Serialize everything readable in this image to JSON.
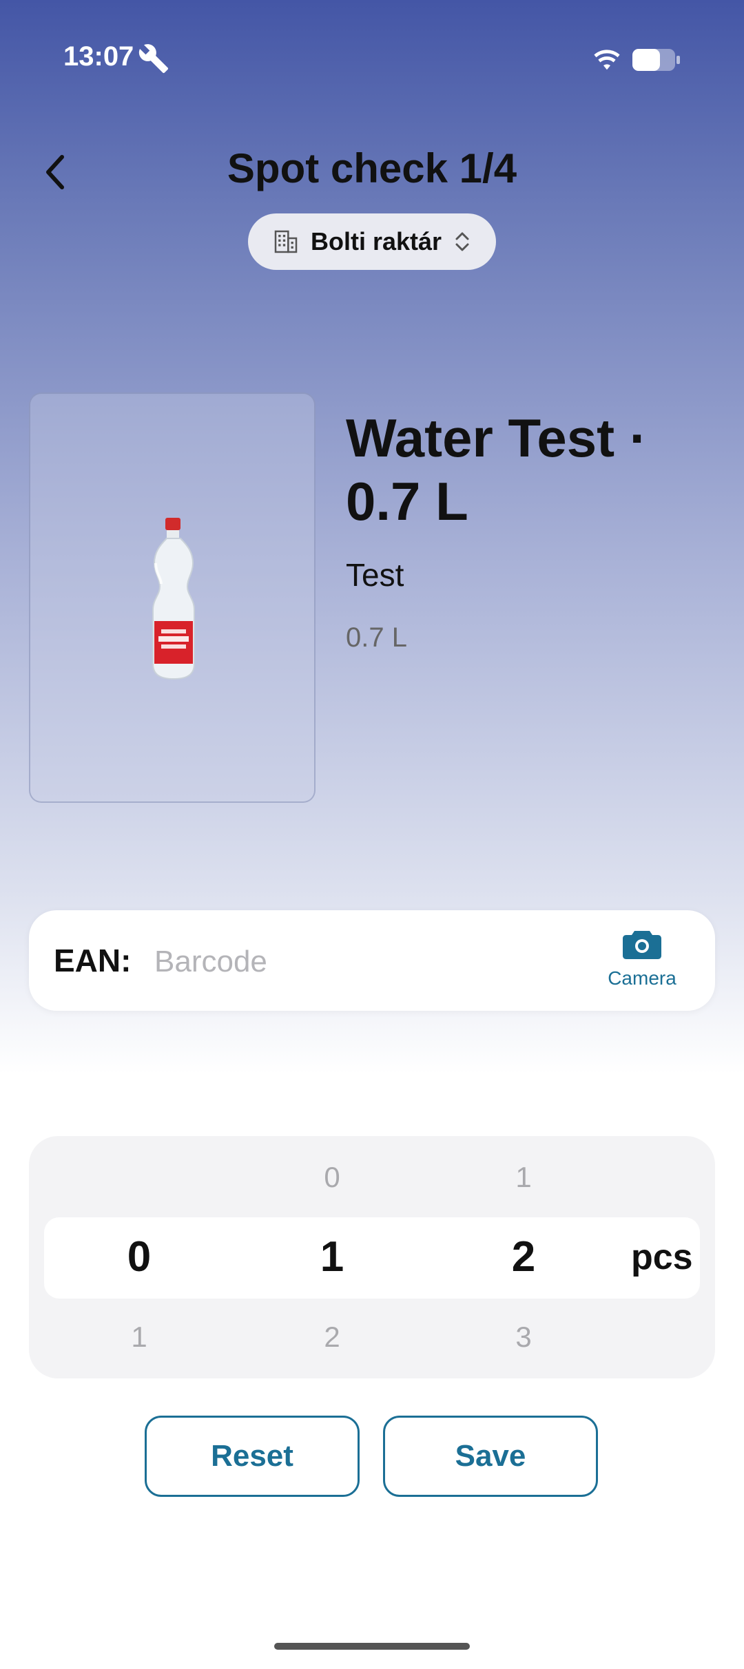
{
  "status_bar": {
    "time": "13:07"
  },
  "header": {
    "title": "Spot check  1/4"
  },
  "location": {
    "label": "Bolti raktár"
  },
  "product": {
    "title": "Water Test · 0.7 L",
    "subtitle": "Test",
    "size": "0.7 L"
  },
  "ean": {
    "label": "EAN:",
    "value": "",
    "placeholder": "Barcode",
    "camera_label": "Camera"
  },
  "quantity_picker": {
    "columns": [
      {
        "above": "",
        "current": "0",
        "below": "1"
      },
      {
        "above": "0",
        "current": "1",
        "below": "2"
      },
      {
        "above": "1",
        "current": "2",
        "below": "3"
      }
    ],
    "unit": "pcs"
  },
  "actions": {
    "reset_label": "Reset",
    "save_label": "Save"
  },
  "colors": {
    "accent": "#1b6f95",
    "header_gradient_top": "#4456a6"
  }
}
